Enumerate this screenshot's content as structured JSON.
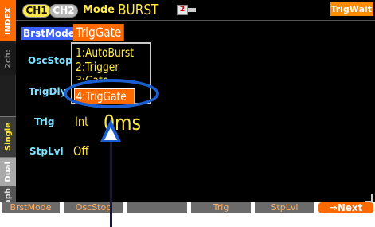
{
  "header": {
    "index_tab": "INDEX",
    "ch1": "CH1",
    "ch2": "CH2",
    "mode_label": "Mode",
    "mode_value": "BURST",
    "num_badge": "2",
    "status": "TrigWait"
  },
  "side_tabs": {
    "ch2": "2ch:",
    "single": "Single",
    "dual": "Dual",
    "graph": "Graph"
  },
  "params": {
    "burst_mode": {
      "label": "BrstMode",
      "value": "TrigGate"
    },
    "osc_stop": {
      "label": "OscStop"
    },
    "trig_dly": {
      "label": "TrigDly"
    },
    "trig": {
      "label": "Trig",
      "value": "Int"
    },
    "stp_lvl": {
      "label": "StpLvl",
      "value": "Off"
    },
    "partial_value": "0ms"
  },
  "dropdown": {
    "options": [
      "1:AutoBurst",
      "2:Trigger",
      "3:Gate",
      "4:TrigGate"
    ],
    "selected_index": 3
  },
  "softkeys": [
    "BrstMode",
    "OscStop",
    "",
    "Trig",
    "StpLvl",
    "⇒Next"
  ],
  "colors": {
    "accent_orange": "#ff6a00",
    "value_yellow": "#ffe84a",
    "label_cyan": "#7fe0ff",
    "highlight_blue": "#1a5fd1"
  }
}
